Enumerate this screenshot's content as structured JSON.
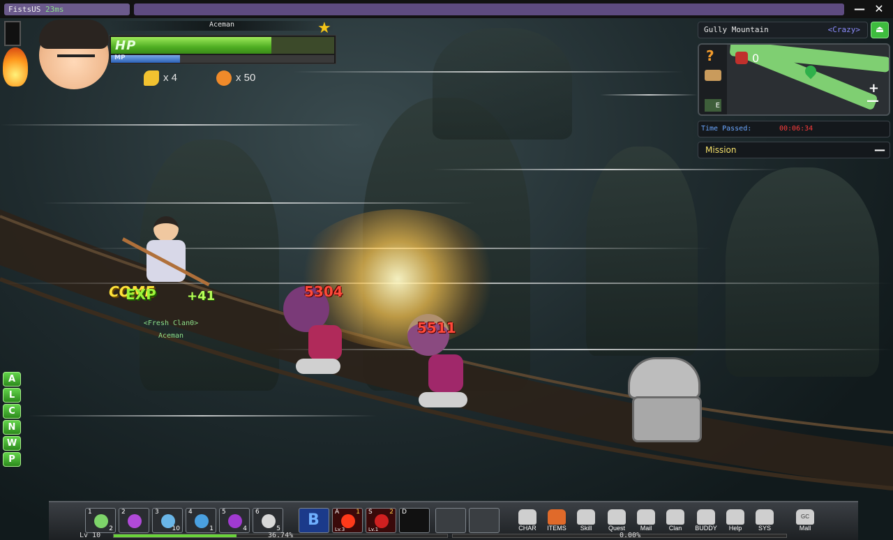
{
  "window": {
    "title": "FistsUS",
    "ping": "23ms",
    "minimize_label": "—",
    "close_label": "✕"
  },
  "player": {
    "name": "Aceman",
    "hp_label": "HP",
    "mp_label": "MP",
    "hp_fraction": 0.72,
    "mp_fraction": 0.31,
    "resource_a_count": "x 4",
    "resource_b_count": "x 50",
    "clan": "<Fresh Clan0>",
    "level": "Lv 10",
    "exp_percent": "36.74%",
    "exp_fraction": 0.3674,
    "exp2_percent": "0.00%"
  },
  "map": {
    "name": "Gully Mountain",
    "difficulty": "<Crazy>",
    "mob_count": "0",
    "quest_mark": "?",
    "e_key": "E",
    "zoom_in": "+",
    "zoom_out": "—"
  },
  "timer": {
    "label": "Time Passed:",
    "value": "00:06:34"
  },
  "mission": {
    "label": "Mission",
    "collapse": "—"
  },
  "shortcuts": [
    "A",
    "L",
    "C",
    "N",
    "W",
    "P"
  ],
  "combat": {
    "combo_text": "COME",
    "exp_text": "EXP",
    "combo_num": "+41",
    "damage_1": "5304",
    "damage_2": "5511"
  },
  "hotbar": {
    "items": [
      {
        "key": "1",
        "count": "2",
        "color": "#7ed46a"
      },
      {
        "key": "2",
        "count": "",
        "color": "#b04ad8"
      },
      {
        "key": "3",
        "count": "10",
        "color": "#6ab6e8"
      },
      {
        "key": "4",
        "count": "1",
        "color": "#4aa0e0"
      },
      {
        "key": "5",
        "count": "4",
        "color": "#a03ad0"
      },
      {
        "key": "6",
        "count": "5",
        "color": "#d8d8d8"
      }
    ],
    "skill_b": "B",
    "skill_a": {
      "key": "A",
      "level": "Lv.3",
      "count": "1"
    },
    "skill_s": {
      "key": "S",
      "level": "Lv.1",
      "count": "2"
    },
    "skill_d": {
      "key": "D"
    },
    "menu": [
      "CHAR",
      "ITEMS",
      "Skill",
      "Quest",
      "Mail",
      "Clan",
      "BUDDY",
      "Help",
      "SYS",
      "Mall"
    ],
    "mall_sub": "GC"
  }
}
